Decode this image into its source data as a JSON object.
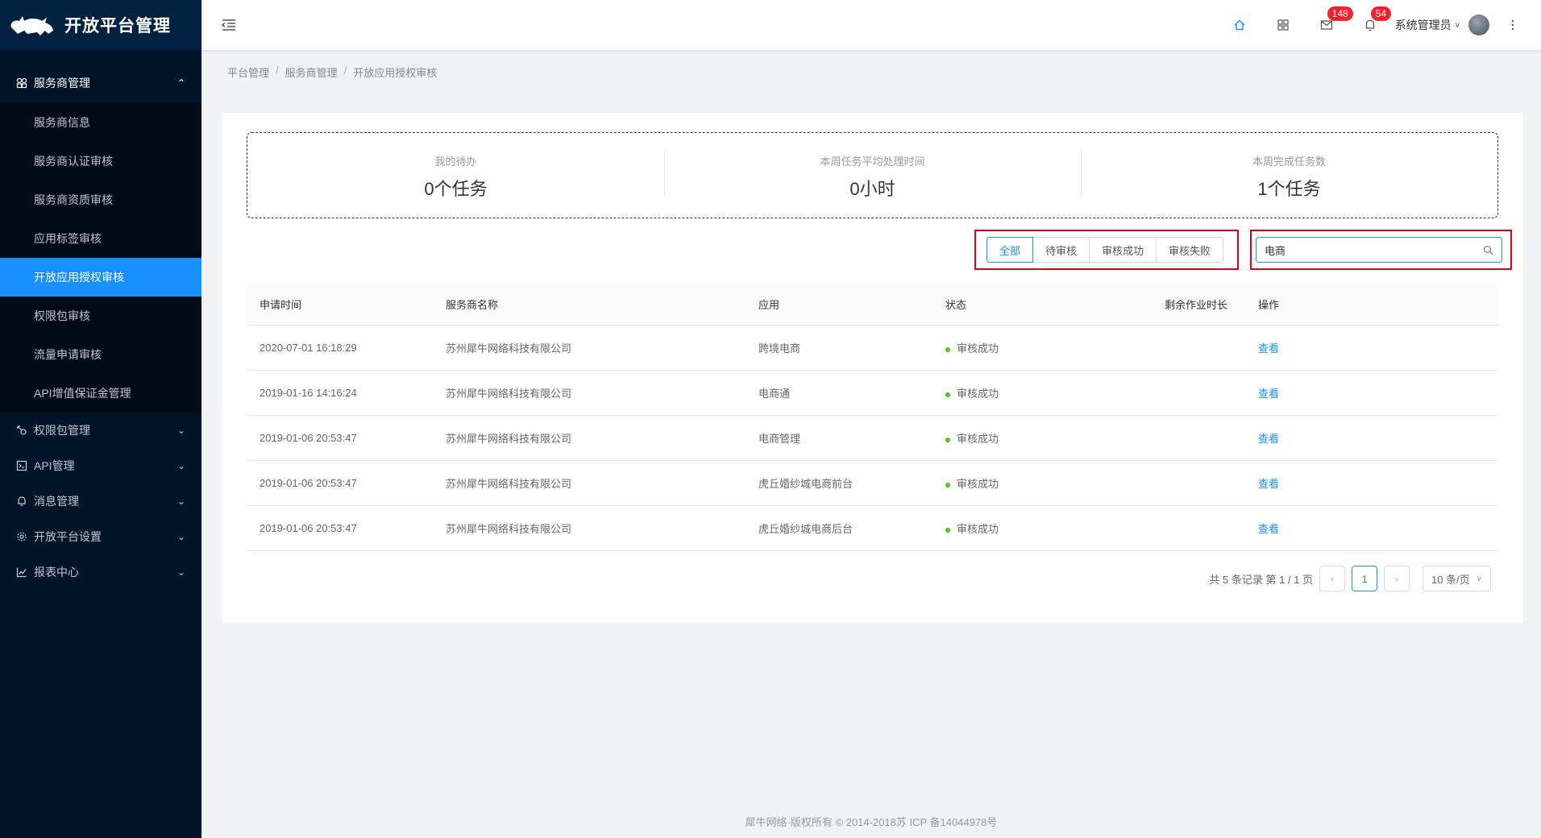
{
  "app": {
    "title": "开放平台管理"
  },
  "sidebar": {
    "group": {
      "label": "服务商管理"
    },
    "subitems": [
      {
        "label": "服务商信息"
      },
      {
        "label": "服务商认证审核"
      },
      {
        "label": "服务商资质审核"
      },
      {
        "label": "应用标签审核"
      },
      {
        "label": "开放应用授权审核"
      },
      {
        "label": "权限包审核"
      },
      {
        "label": "流量申请审核"
      },
      {
        "label": "API增值保证金管理"
      }
    ],
    "items": [
      {
        "label": "权限包管理",
        "icon": "key-icon"
      },
      {
        "label": "API管理",
        "icon": "api-icon"
      },
      {
        "label": "消息管理",
        "icon": "bell-icon"
      },
      {
        "label": "开放平台设置",
        "icon": "gear-icon"
      },
      {
        "label": "报表中心",
        "icon": "chart-icon"
      }
    ]
  },
  "header": {
    "mail_badge": "148",
    "bell_badge": "54",
    "user": "系统管理员"
  },
  "breadcrumb": [
    "平台管理",
    "服务商管理",
    "开放应用授权审核"
  ],
  "stats": [
    {
      "label": "我的待办",
      "value": "0个任务"
    },
    {
      "label": "本周任务平均处理时间",
      "value": "0小时"
    },
    {
      "label": "本周完成任务数",
      "value": "1个任务"
    }
  ],
  "filters": [
    "全部",
    "待审核",
    "审核成功",
    "审核失败"
  ],
  "search": {
    "value": "电商"
  },
  "table": {
    "headers": [
      "申请时间",
      "服务商名称",
      "应用",
      "状态",
      "剩余作业时长",
      "操作"
    ],
    "rows": [
      {
        "time": "2020-07-01 16:18:29",
        "company": "苏州犀牛网络科技有限公司",
        "app": "跨境电商",
        "status": "审核成功",
        "remain": "",
        "action": "查看"
      },
      {
        "time": "2019-01-16 14:16:24",
        "company": "苏州犀牛网络科技有限公司",
        "app": "电商通",
        "status": "审核成功",
        "remain": "",
        "action": "查看"
      },
      {
        "time": "2019-01-06 20:53:47",
        "company": "苏州犀牛网络科技有限公司",
        "app": "电商管理",
        "status": "审核成功",
        "remain": "",
        "action": "查看"
      },
      {
        "time": "2019-01-06 20:53:47",
        "company": "苏州犀牛网络科技有限公司",
        "app": "虎丘婚纱城电商前台",
        "status": "审核成功",
        "remain": "",
        "action": "查看"
      },
      {
        "time": "2019-01-06 20:53:47",
        "company": "苏州犀牛网络科技有限公司",
        "app": "虎丘婚纱城电商后台",
        "status": "审核成功",
        "remain": "",
        "action": "查看"
      }
    ]
  },
  "pagination": {
    "summary": "共 5 条记录 第 1 / 1 页",
    "current": "1",
    "page_size": "10 条/页"
  },
  "footer": {
    "text": "犀牛网络·版权所有 © 2014-2018苏 ICP 备14044978号"
  },
  "colors": {
    "primary": "#1890ff",
    "sidebar_bg": "#001529",
    "success": "#52c41a",
    "highlight": "#e60012"
  }
}
